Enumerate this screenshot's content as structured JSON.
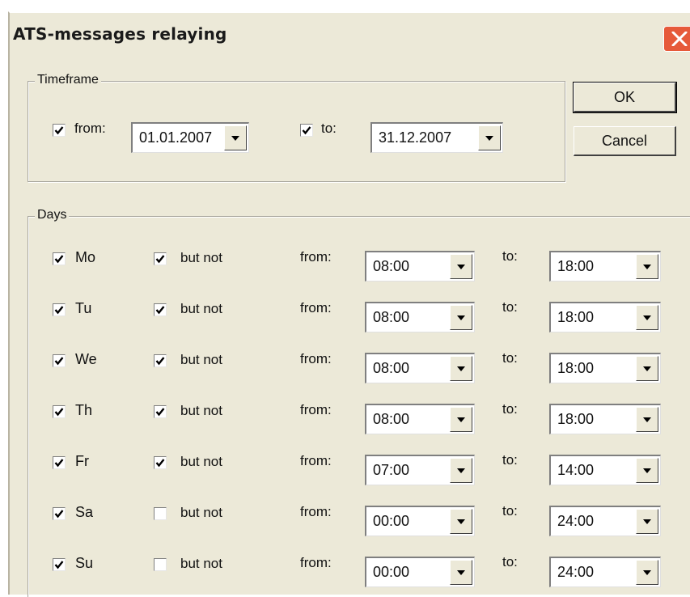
{
  "dialog": {
    "title": "ATS-messages relaying"
  },
  "buttons": {
    "ok": "OK",
    "cancel": "Cancel"
  },
  "timeframe": {
    "legend": "Timeframe",
    "from_checked": true,
    "from_label": "from:",
    "from_value": "01.01.2007",
    "to_checked": true,
    "to_label": "to:",
    "to_value": "31.12.2007"
  },
  "days": {
    "legend": "Days",
    "rows": [
      {
        "day": "Mo",
        "day_checked": true,
        "but_not_label": "but not",
        "but_not_checked": true,
        "from_label": "from:",
        "from": "08:00",
        "to_label": "to:",
        "to": "18:00"
      },
      {
        "day": "Tu",
        "day_checked": true,
        "but_not_label": "but not",
        "but_not_checked": true,
        "from_label": "from:",
        "from": "08:00",
        "to_label": "to:",
        "to": "18:00"
      },
      {
        "day": "We",
        "day_checked": true,
        "but_not_label": "but not",
        "but_not_checked": true,
        "from_label": "from:",
        "from": "08:00",
        "to_label": "to:",
        "to": "18:00"
      },
      {
        "day": "Th",
        "day_checked": true,
        "but_not_label": "but not",
        "but_not_checked": true,
        "from_label": "from:",
        "from": "08:00",
        "to_label": "to:",
        "to": "18:00"
      },
      {
        "day": "Fr",
        "day_checked": true,
        "but_not_label": "but not",
        "but_not_checked": true,
        "from_label": "from:",
        "from": "07:00",
        "to_label": "to:",
        "to": "14:00"
      },
      {
        "day": "Sa",
        "day_checked": true,
        "but_not_label": "but not",
        "but_not_checked": false,
        "from_label": "from:",
        "from": "00:00",
        "to_label": "to:",
        "to": "24:00"
      },
      {
        "day": "Su",
        "day_checked": true,
        "but_not_label": "but not",
        "but_not_checked": false,
        "from_label": "from:",
        "from": "00:00",
        "to_label": "to:",
        "to": "24:00"
      }
    ]
  },
  "colors": {
    "dialog_bg": "#ece9d8",
    "close_button": "#e65a3a",
    "field_bg": "#ffffff",
    "text": "#111111"
  },
  "icons": {
    "close": "close-icon",
    "check": "checkmark-icon",
    "dropdown": "chevron-down-icon"
  }
}
